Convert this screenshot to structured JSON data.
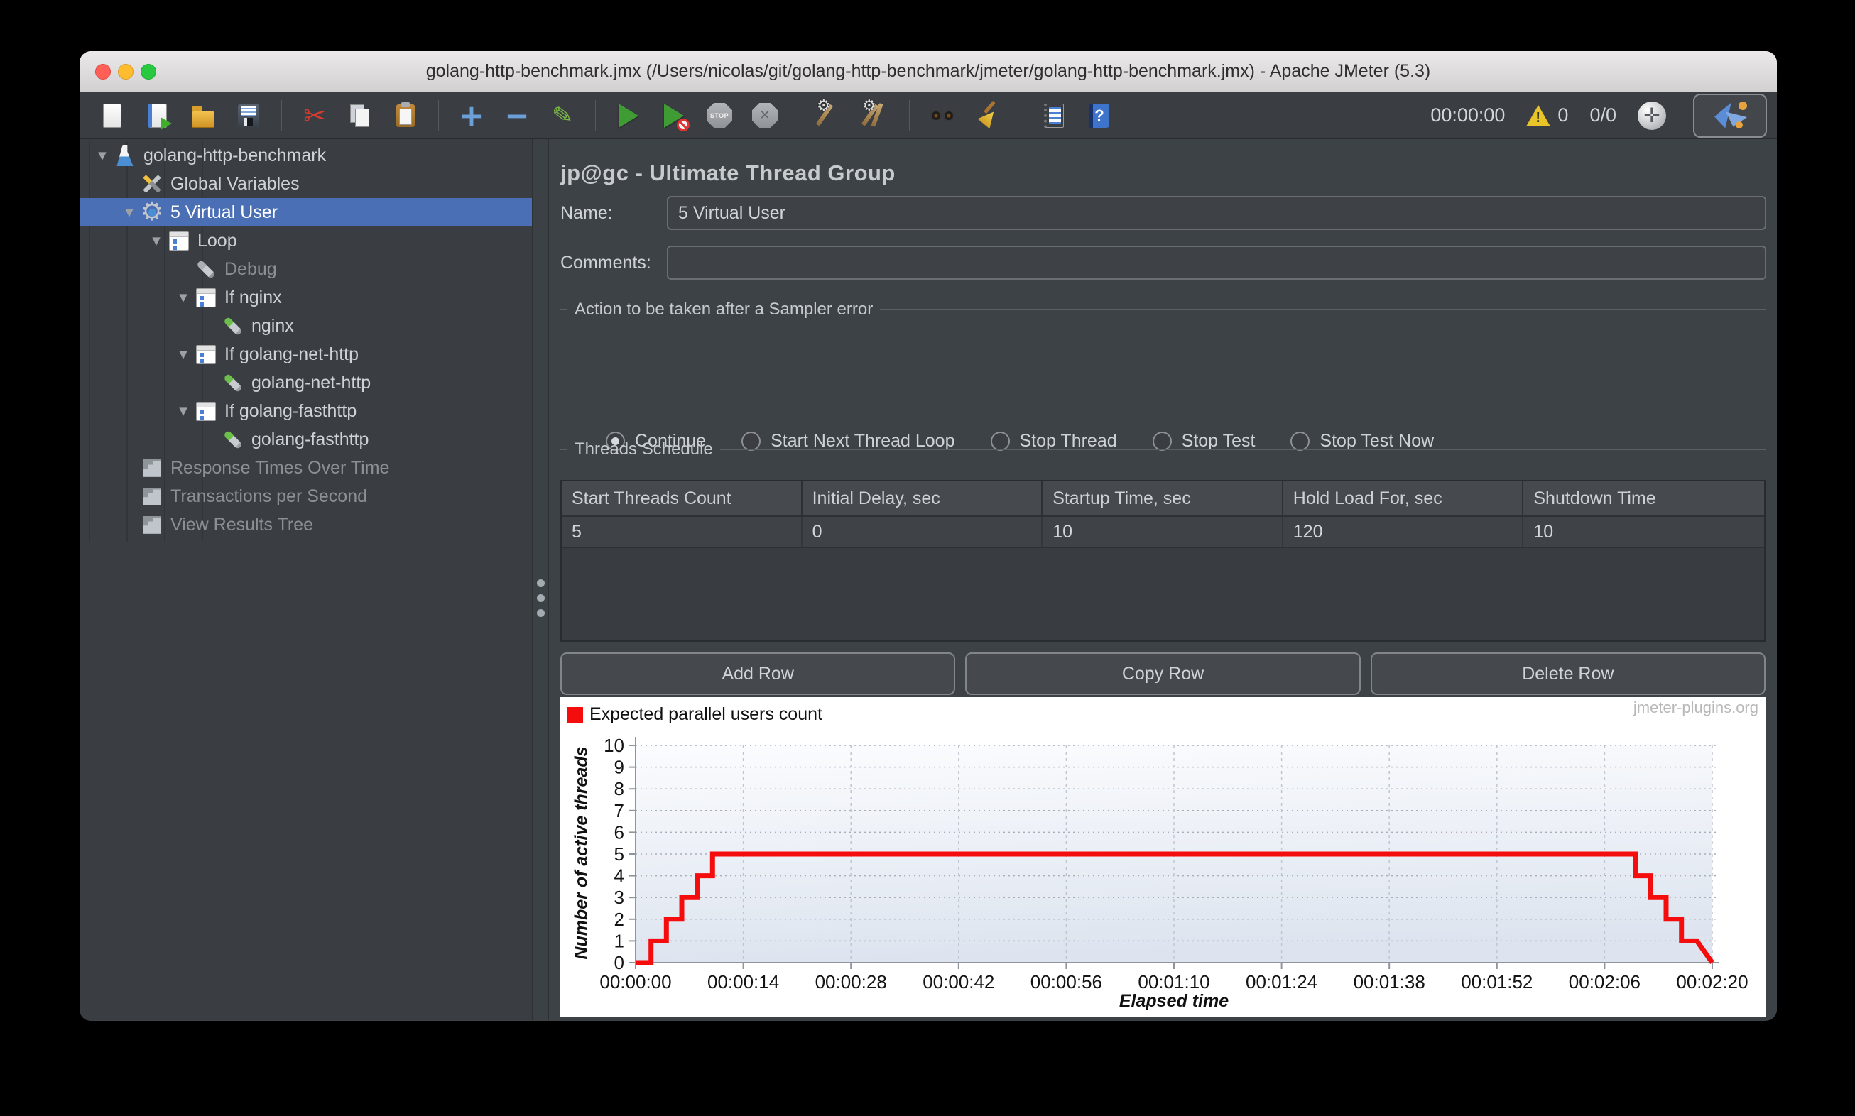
{
  "window": {
    "title": "golang-http-benchmark.jmx (/Users/nicolas/git/golang-http-benchmark/jmeter/golang-http-benchmark.jmx) - Apache JMeter (5.3)"
  },
  "toolbar": {
    "items": [
      {
        "name": "new-file"
      },
      {
        "name": "open-templates"
      },
      {
        "name": "open-file"
      },
      {
        "name": "save"
      },
      {
        "sep": true
      },
      {
        "name": "cut",
        "glyph": "✂"
      },
      {
        "name": "copy"
      },
      {
        "name": "paste"
      },
      {
        "sep": true
      },
      {
        "name": "add",
        "glyph": "+"
      },
      {
        "name": "remove",
        "glyph": "−"
      },
      {
        "name": "toggle",
        "glyph": "✎"
      },
      {
        "sep": true
      },
      {
        "name": "start"
      },
      {
        "name": "start-no-pauses"
      },
      {
        "name": "stop",
        "glyph": "STOP"
      },
      {
        "name": "shutdown",
        "glyph": "✕"
      },
      {
        "sep": true
      },
      {
        "name": "clear",
        "glyph": "⚙"
      },
      {
        "name": "clear-all",
        "glyph": "⚙"
      },
      {
        "sep": true
      },
      {
        "name": "search"
      },
      {
        "name": "reset-search"
      },
      {
        "sep": true
      },
      {
        "name": "function-helper"
      },
      {
        "name": "help",
        "glyph": "?"
      }
    ],
    "status": {
      "elapsed": "00:00:00",
      "warning_glyph": "!",
      "warning_count": "0",
      "thread_counts": "0/0"
    }
  },
  "tree": {
    "items": [
      {
        "label": "golang-http-benchmark",
        "depth": 0,
        "icon": "flask",
        "expander": true
      },
      {
        "label": "Global Variables",
        "depth": 1,
        "icon": "tools"
      },
      {
        "label": "5 Virtual User",
        "depth": 1,
        "icon": "gear",
        "expander": true,
        "selected": true
      },
      {
        "label": "Loop",
        "depth": 2,
        "icon": "controller",
        "expander": true
      },
      {
        "label": "Debug",
        "depth": 3,
        "icon": "dropper-gray",
        "disabled": true
      },
      {
        "label": "If nginx",
        "depth": 3,
        "icon": "controller",
        "expander": true
      },
      {
        "label": "nginx",
        "depth": 4,
        "icon": "dropper-green"
      },
      {
        "label": "If golang-net-http",
        "depth": 3,
        "icon": "controller",
        "expander": true
      },
      {
        "label": "golang-net-http",
        "depth": 4,
        "icon": "dropper-green"
      },
      {
        "label": "If golang-fasthttp",
        "depth": 3,
        "icon": "controller",
        "expander": true
      },
      {
        "label": "golang-fasthttp",
        "depth": 4,
        "icon": "dropper-green"
      },
      {
        "label": "Response Times Over Time",
        "depth": 1,
        "icon": "listener-chart",
        "disabled": true
      },
      {
        "label": "Transactions per Second",
        "depth": 1,
        "icon": "listener-chart",
        "disabled": true
      },
      {
        "label": "View Results Tree",
        "depth": 1,
        "icon": "listener-chart",
        "disabled": true
      }
    ],
    "expander_glyph": "▼"
  },
  "main": {
    "title": "jp@gc - Ultimate Thread Group",
    "name_label": "Name:",
    "name_value": "5 Virtual User",
    "comments_label": "Comments:",
    "comments_value": "",
    "sampler_error": {
      "title": "Action to be taken after a Sampler error",
      "options": [
        {
          "label": "Continue",
          "selected": true
        },
        {
          "label": "Start Next Thread Loop",
          "selected": false
        },
        {
          "label": "Stop Thread",
          "selected": false
        },
        {
          "label": "Stop Test",
          "selected": false
        },
        {
          "label": "Stop Test Now",
          "selected": false
        }
      ]
    },
    "threads_schedule": {
      "title": "Threads Schedule",
      "columns": [
        "Start Threads Count",
        "Initial Delay, sec",
        "Startup Time, sec",
        "Hold Load For, sec",
        "Shutdown Time"
      ],
      "rows": [
        [
          "5",
          "0",
          "10",
          "120",
          "10"
        ]
      ]
    },
    "buttons": [
      "Add Row",
      "Copy Row",
      "Delete Row"
    ]
  },
  "chart_data": {
    "type": "line",
    "title": "Expected parallel users count",
    "legend": [
      {
        "label": "Expected parallel users count",
        "color": "#f50d0d"
      }
    ],
    "legend_position": "top-left",
    "watermark": "jmeter-plugins.org",
    "xlabel": "Elapsed time",
    "ylabel": "Number of active threads",
    "grid": true,
    "ylim": [
      0,
      10
    ],
    "xlim_seconds": [
      0,
      140
    ],
    "y_ticks": [
      0,
      1,
      2,
      3,
      4,
      5,
      6,
      7,
      8,
      9,
      10
    ],
    "x_ticks_seconds": [
      0,
      14,
      28,
      42,
      56,
      70,
      84,
      98,
      112,
      126,
      140
    ],
    "x_tick_labels": [
      "00:00:00",
      "00:00:14",
      "00:00:28",
      "00:00:42",
      "00:00:56",
      "00:01:10",
      "00:01:24",
      "00:01:38",
      "00:01:52",
      "00:02:06",
      "00:02:20"
    ],
    "series": [
      {
        "name": "Expected parallel users count",
        "color": "#f50d0d",
        "points_t_v": [
          [
            0,
            0
          ],
          [
            2,
            0
          ],
          [
            2,
            1
          ],
          [
            4,
            1
          ],
          [
            4,
            2
          ],
          [
            6,
            2
          ],
          [
            6,
            3
          ],
          [
            8,
            3
          ],
          [
            8,
            4
          ],
          [
            10,
            4
          ],
          [
            10,
            5
          ],
          [
            130,
            5
          ],
          [
            130,
            4
          ],
          [
            132,
            4
          ],
          [
            132,
            3
          ],
          [
            134,
            3
          ],
          [
            134,
            2
          ],
          [
            136,
            2
          ],
          [
            136,
            1
          ],
          [
            138,
            1
          ],
          [
            140,
            0
          ]
        ]
      }
    ]
  },
  "colors": {
    "accent_selection": "#4a6fb5",
    "panel_bg": "#3d4247",
    "tree_bg": "#3a3e43",
    "series_red": "#f50d0d",
    "titlebar_top": "#ebe9ea"
  }
}
